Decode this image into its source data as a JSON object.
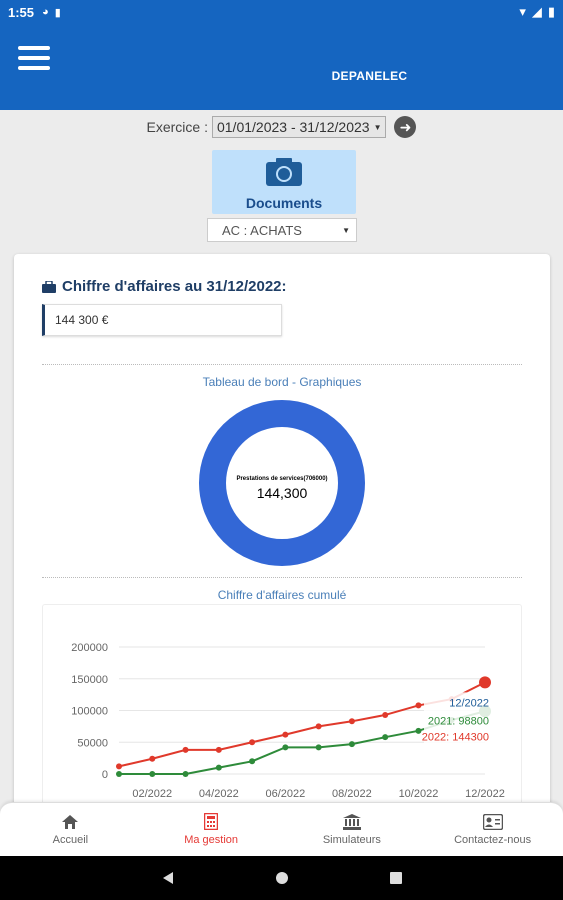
{
  "status": {
    "time": "1:55"
  },
  "app": {
    "title": "DEPANELEC"
  },
  "exercice": {
    "label": "Exercice :",
    "value": "01/01/2023 - 31/12/2023"
  },
  "documents": {
    "label": "Documents"
  },
  "journal": {
    "value": "AC : ACHATS"
  },
  "ca": {
    "title": "Chiffre d'affaires au 31/12/2022:",
    "value": "144 300 €"
  },
  "dashboard": {
    "title": "Tableau de bord - Graphiques",
    "donut_label": "Prestations de services(706000)",
    "donut_value": "144,300"
  },
  "cumul": {
    "title": "Chiffre d'affaires cumulé"
  },
  "chart_data": {
    "type": "line",
    "title": "Chiffre d'affaires cumulé",
    "x": [
      "01/2022",
      "02/2022",
      "03/2022",
      "04/2022",
      "05/2022",
      "06/2022",
      "07/2022",
      "08/2022",
      "09/2022",
      "10/2022",
      "11/2022",
      "12/2022"
    ],
    "x_tick_labels": [
      "02/2022",
      "04/2022",
      "06/2022",
      "08/2022",
      "10/2022",
      "12/2022"
    ],
    "y_ticks": [
      "200000",
      "150000",
      "100000",
      "50000",
      "0"
    ],
    "ylim": [
      0,
      200000
    ],
    "series": [
      {
        "name": "2021",
        "color": "#2e8b3a",
        "values": [
          0,
          0,
          0,
          10000,
          20000,
          42000,
          42000,
          47000,
          58000,
          68000,
          85000,
          98800
        ]
      },
      {
        "name": "2022",
        "color": "#e0392b",
        "values": [
          12000,
          24000,
          38000,
          38000,
          50000,
          62000,
          75000,
          83000,
          93000,
          108000,
          118000,
          144300
        ]
      }
    ],
    "tooltip": {
      "title": "12/2022",
      "lines": [
        "2021: 98800",
        "2022: 144300"
      ]
    }
  },
  "nav": [
    {
      "label": "Accueil",
      "icon": "home-icon"
    },
    {
      "label": "Ma gestion",
      "icon": "calculator-icon",
      "active": true
    },
    {
      "label": "Simulateurs",
      "icon": "bank-icon"
    },
    {
      "label": "Contactez-nous",
      "icon": "contact-card-icon"
    }
  ],
  "colors": {
    "primary": "#1565c0",
    "accent": "#e53935",
    "donut": "#3367d6"
  }
}
